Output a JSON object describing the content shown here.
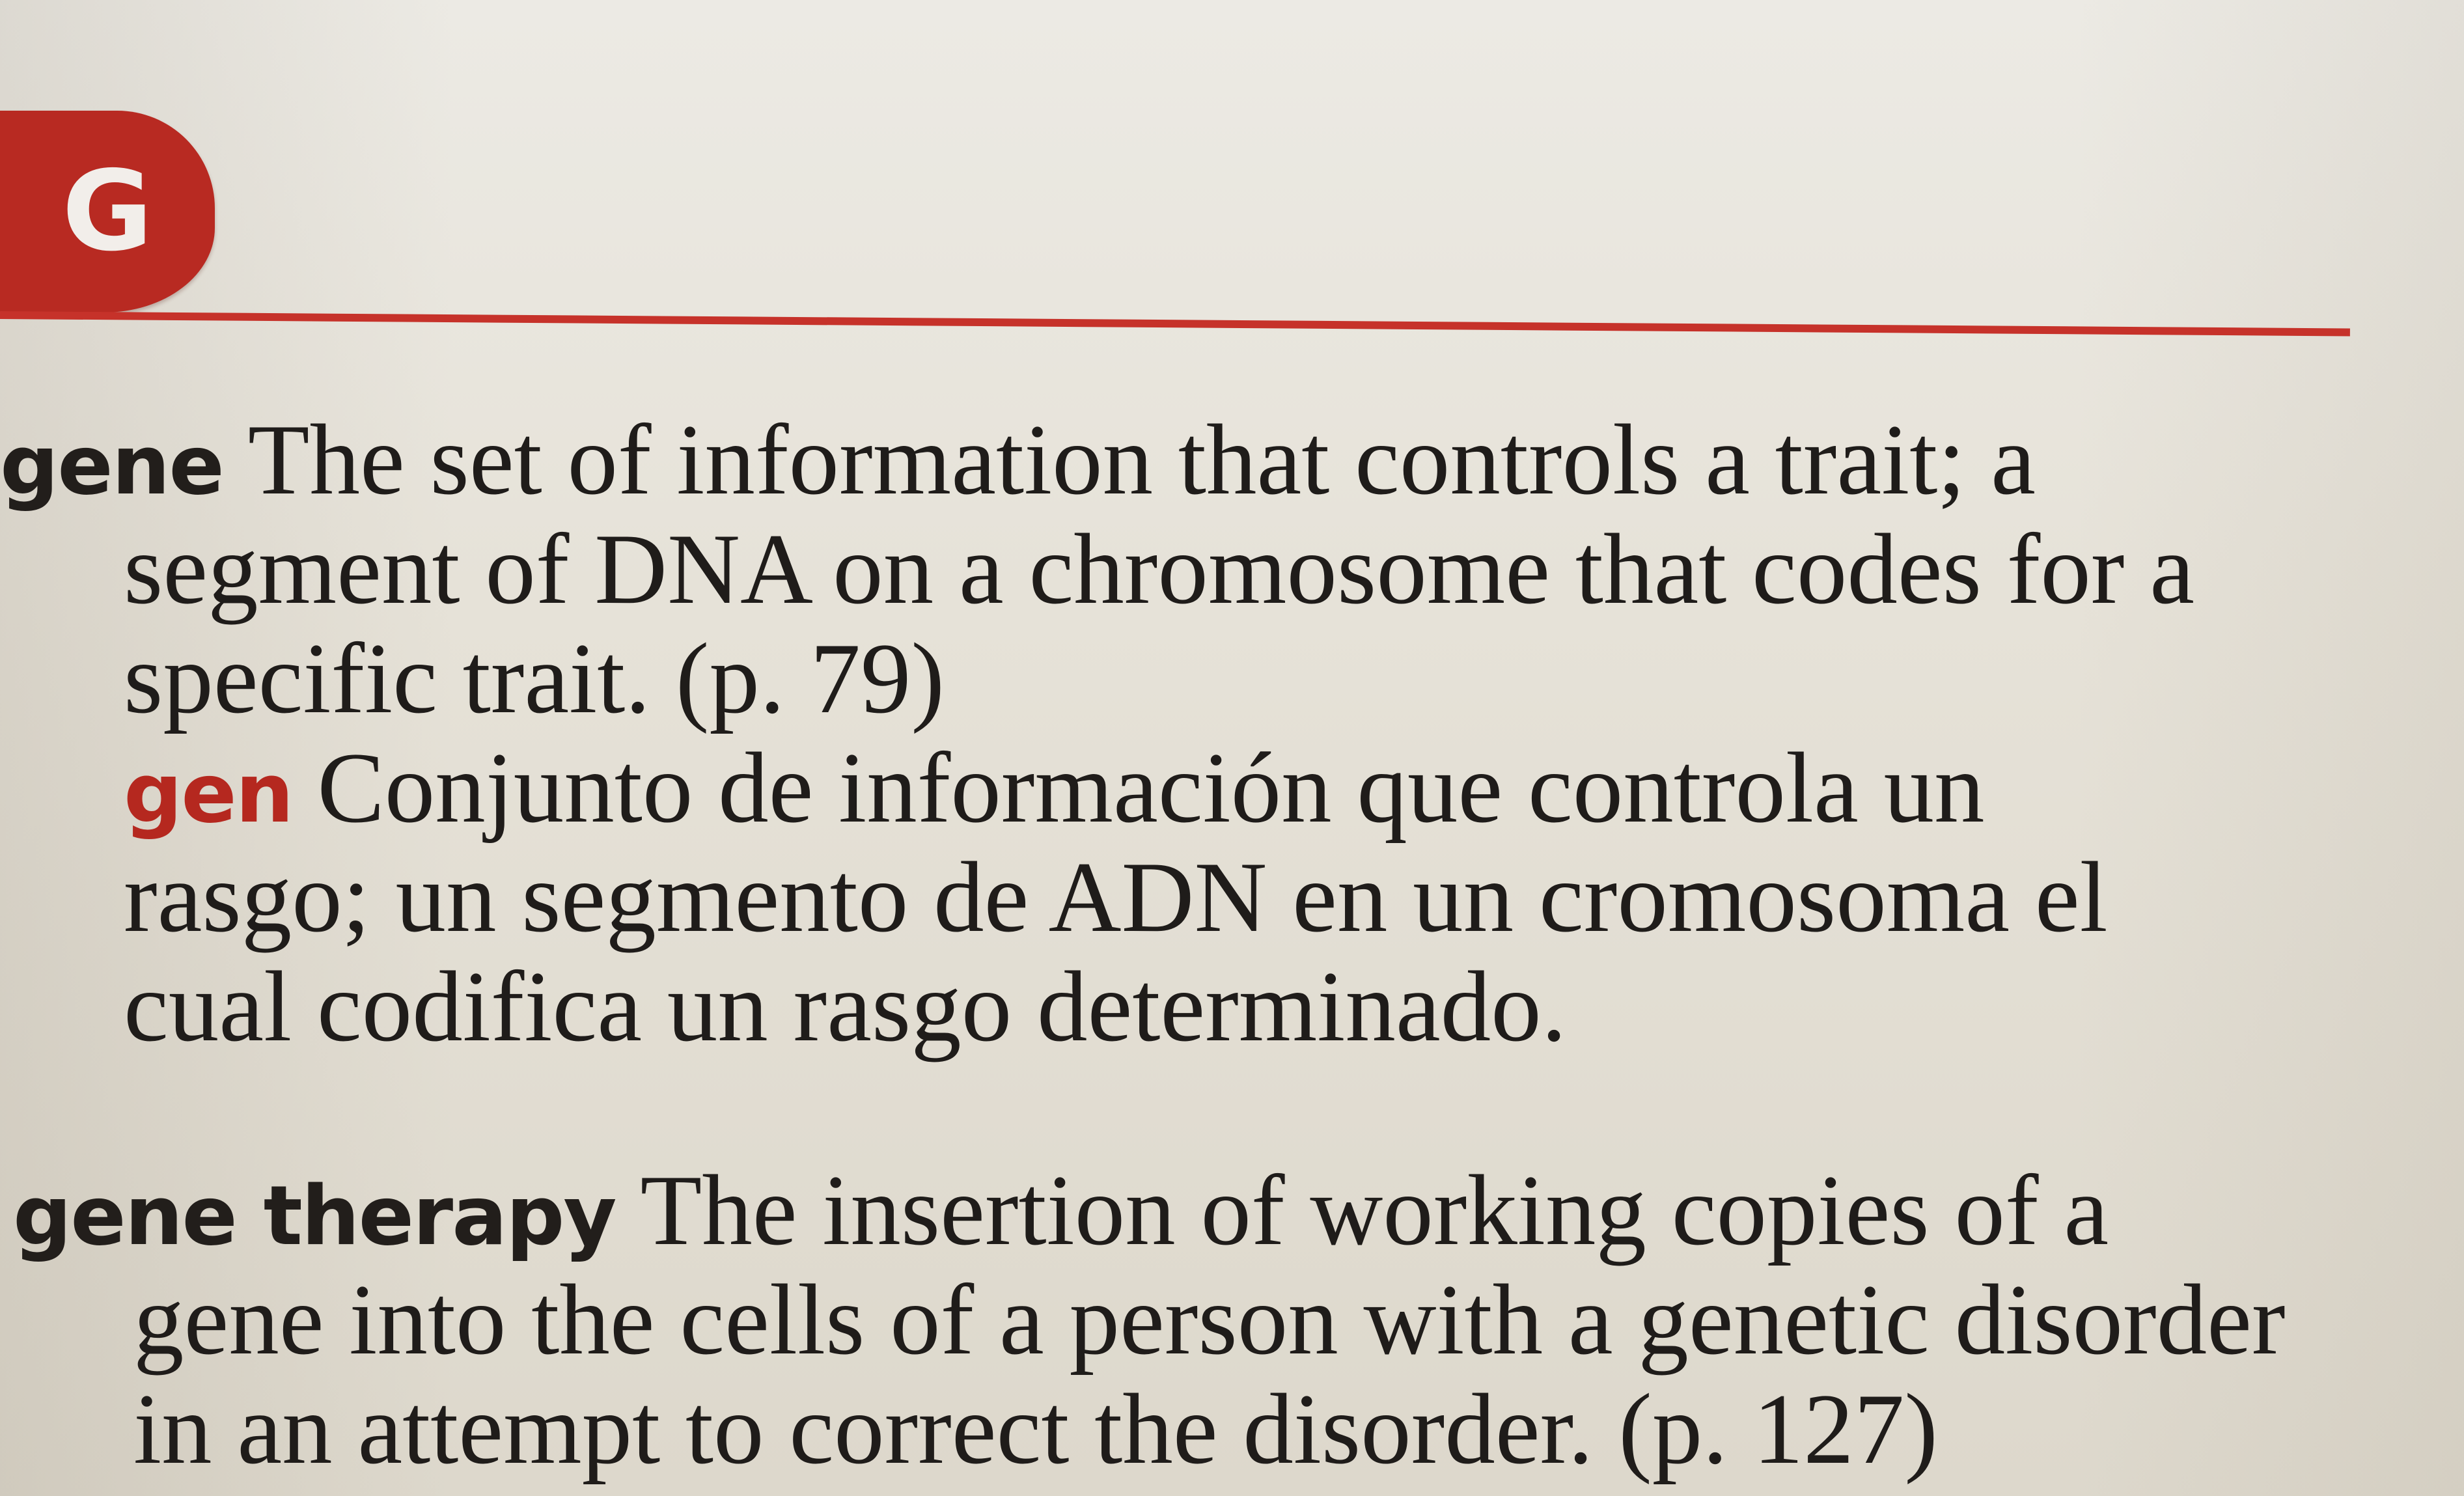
{
  "section": {
    "letter": "G",
    "accent_color": "#b82a22"
  },
  "entries": [
    {
      "term": "gene",
      "definition_lines": [
        "The set of information that controls a trait; a",
        "segment of DNA on a chromosome that codes for a",
        "specific trait. (p. 79)"
      ],
      "spanish": {
        "term": "gen",
        "definition_lines": [
          "Conjunto de información que controla un",
          "rasgo; un segmento de ADN en un cromosoma el",
          "cual codifica un rasgo determinado."
        ]
      }
    },
    {
      "term": "gene therapy",
      "definition_lines": [
        "The insertion of working copies of a",
        "gene into the cells of a person with a genetic disorder",
        "in an attempt to correct the disorder. (p. 127)"
      ]
    }
  ]
}
